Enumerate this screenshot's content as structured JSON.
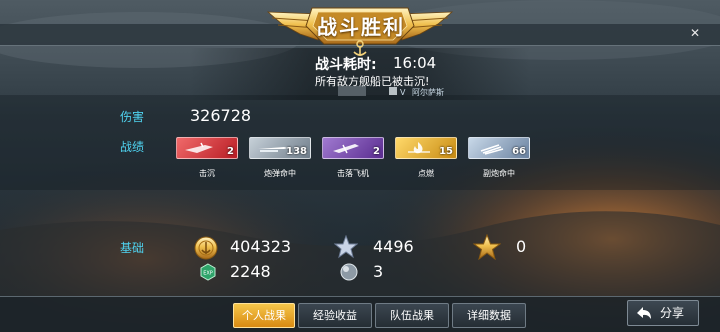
{
  "header": {
    "title": "战斗胜利",
    "battle_time_label": "战斗耗时:",
    "battle_time_value": "16:04",
    "sunk_message": "所有敌方舰船已被击沉!",
    "mvp_prefix": "V",
    "mvp_name": "阿尔萨斯"
  },
  "damage": {
    "label": "伤害",
    "value": "326728"
  },
  "record": {
    "label": "战绩",
    "medals": [
      {
        "label": "击沉",
        "count": "2",
        "color": "#d8323a",
        "icon": "sinking-ship-icon"
      },
      {
        "label": "炮弹命中",
        "count": "138",
        "color": "#8a97a4",
        "icon": "shell-icon"
      },
      {
        "label": "击落飞机",
        "count": "2",
        "color": "#7d4ab0",
        "icon": "plane-shot-icon"
      },
      {
        "label": "点燃",
        "count": "15",
        "color": "#e6b22a",
        "icon": "fire-icon"
      },
      {
        "label": "副炮命中",
        "count": "66",
        "color": "#8a9fb4",
        "icon": "secondary-gun-icon"
      }
    ]
  },
  "base": {
    "label": "基础",
    "gold_value": "404323",
    "star_value": "4496",
    "gold_star_value": "0",
    "exp_value": "2248",
    "exp_icon_text": "EXP",
    "pearl_value": "3"
  },
  "tabs": [
    {
      "label": "个人战果",
      "active": true
    },
    {
      "label": "经验收益",
      "active": false
    },
    {
      "label": "队伍战果",
      "active": false
    },
    {
      "label": "详细数据",
      "active": false
    }
  ],
  "share_label": "分享",
  "colors": {
    "accent": "#4fd3f0",
    "tab_active": "#f0b430"
  }
}
